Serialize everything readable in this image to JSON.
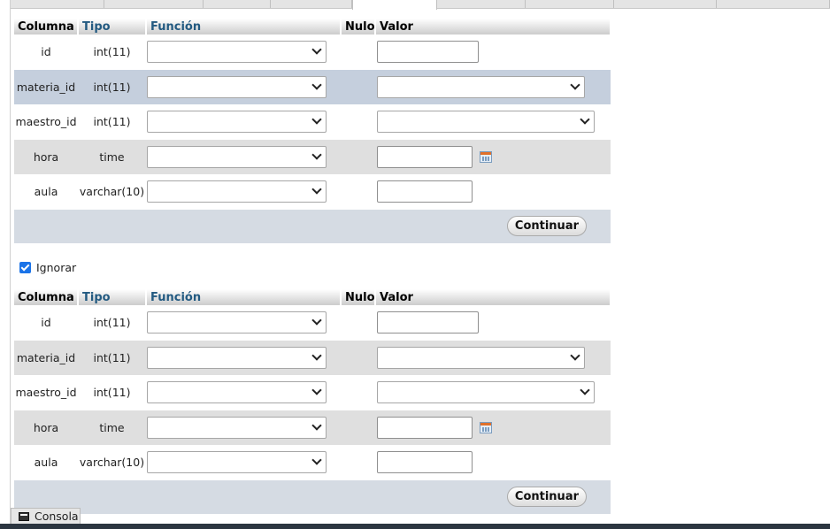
{
  "columns_header": {
    "columna": "Columna",
    "tipo": "Tipo",
    "funcion": "Función",
    "nulo": "Nulo",
    "valor": "Valor"
  },
  "form1": {
    "rows": [
      {
        "name": "id",
        "type": "int(11)",
        "value_widget": "text-input",
        "function": "",
        "value": ""
      },
      {
        "name": "materia_id",
        "type": "int(11)",
        "value_widget": "select",
        "function": "",
        "value": ""
      },
      {
        "name": "maestro_id",
        "type": "int(11)",
        "value_widget": "select",
        "function": "",
        "value": ""
      },
      {
        "name": "hora",
        "type": "time",
        "value_widget": "time-input",
        "function": "",
        "value": ""
      },
      {
        "name": "aula",
        "type": "varchar(10)",
        "value_widget": "text-input",
        "function": "",
        "value": ""
      }
    ],
    "continue_label": "Continuar"
  },
  "ignorar": {
    "label": "Ignorar",
    "checked": true
  },
  "form2": {
    "rows": [
      {
        "name": "id",
        "type": "int(11)",
        "value_widget": "text-input",
        "function": "",
        "value": ""
      },
      {
        "name": "materia_id",
        "type": "int(11)",
        "value_widget": "select",
        "function": "",
        "value": ""
      },
      {
        "name": "maestro_id",
        "type": "int(11)",
        "value_widget": "select",
        "function": "",
        "value": ""
      },
      {
        "name": "hora",
        "type": "time",
        "value_widget": "time-input",
        "function": "",
        "value": ""
      },
      {
        "name": "aula",
        "type": "varchar(10)",
        "value_widget": "text-input",
        "function": "",
        "value": ""
      }
    ],
    "continue_label": "Continuar"
  },
  "console": {
    "label": "Consola",
    "icon": "terminal-icon"
  },
  "colors": {
    "header_link": "#235a81",
    "row_even": "#dfdfdf",
    "row_marked": "#c5cfdd",
    "footer": "#d5dbe3",
    "checkbox": "#1a73e8"
  }
}
